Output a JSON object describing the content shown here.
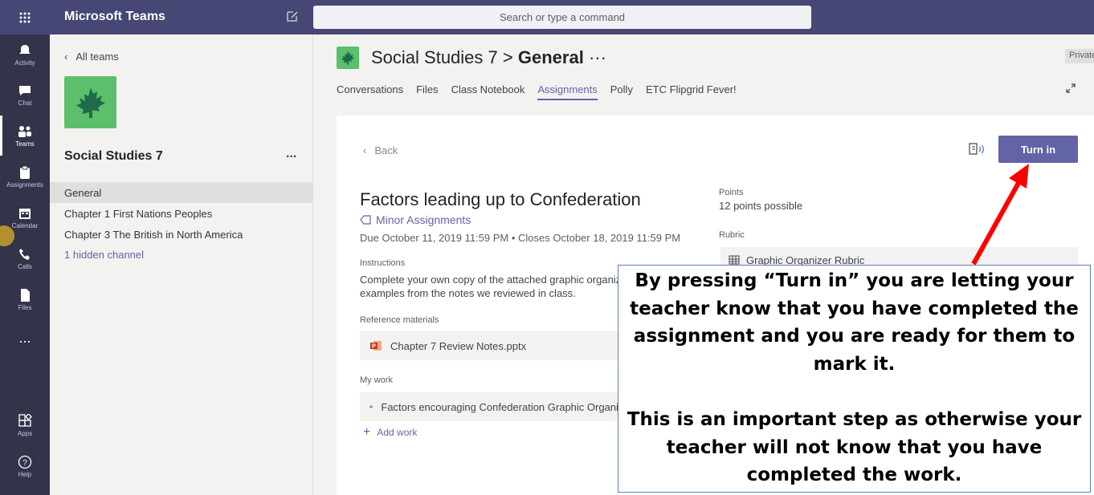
{
  "topbar": {
    "app_title": "Microsoft Teams",
    "search_placeholder": "Search or type a command"
  },
  "rail": {
    "items": [
      {
        "label": "Activity",
        "icon": "bell-icon"
      },
      {
        "label": "Chat",
        "icon": "chat-icon"
      },
      {
        "label": "Teams",
        "icon": "teams-icon",
        "active": true
      },
      {
        "label": "Assignments",
        "icon": "assignments-icon"
      },
      {
        "label": "Calendar",
        "icon": "calendar-icon"
      },
      {
        "label": "Calls",
        "icon": "phone-icon"
      },
      {
        "label": "Files",
        "icon": "files-icon"
      }
    ],
    "more": "...",
    "apps_label": "Apps",
    "help_label": "Help"
  },
  "teams_panel": {
    "all_teams": "All teams",
    "team_name": "Social Studies 7",
    "more": "...",
    "channels": [
      {
        "label": "General",
        "selected": true
      },
      {
        "label": "Chapter 1 First Nations Peoples"
      },
      {
        "label": "Chapter 3 The British in North America"
      },
      {
        "label": "1 hidden channel"
      }
    ]
  },
  "header": {
    "team": "Social Studies 7",
    "separator": ">",
    "channel": "General",
    "more": "···",
    "badge": "Private",
    "tabs": [
      "Conversations",
      "Files",
      "Class Notebook",
      "Assignments",
      "Polly",
      "ETC Flipgrid Fever!"
    ],
    "active_tab": "Assignments"
  },
  "assignment": {
    "back_label": "Back",
    "turn_in_label": "Turn in",
    "title": "Factors leading up to Confederation",
    "category": "Minor Assignments",
    "dates": "Due October 11, 2019 11:59 PM  •  Closes October 18, 2019 11:59 PM",
    "instructions_label": "Instructions",
    "instructions_line1": "Complete your own copy of the attached graphic organizer",
    "instructions_line2": "examples from the notes we reviewed in class.",
    "reference_label": "Reference materials",
    "reference_file": "Chapter 7 Review Notes.pptx",
    "my_work_label": "My work",
    "my_work_file": "Factors encouraging Confederation Graphic Organizer",
    "add_work": "Add work",
    "points_label": "Points",
    "points_value": "12 points possible",
    "rubric_label": "Rubric",
    "rubric_name": "Graphic Organizer Rubric"
  },
  "annotation": {
    "line1": "By pressing “Turn in” you are letting your",
    "line2": "teacher know that you have completed the",
    "line3": "assignment and you are ready for them to",
    "line4": "mark it.",
    "line5": "This is an important step as otherwise your",
    "line6": "teacher will not know that you have",
    "line7": "completed the work.",
    "arrow_color": "#ff0000",
    "border_color": "#5b7fb5"
  },
  "colors": {
    "brand": "#464775",
    "accent": "#6264a7",
    "rail": "#33344a",
    "team_green": "#5bbf6b"
  }
}
